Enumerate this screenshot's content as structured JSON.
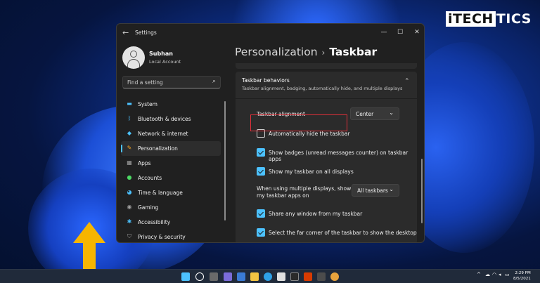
{
  "watermark": {
    "highlight": "iTECH",
    "rest": "TICS"
  },
  "window": {
    "title": "Settings",
    "back_glyph": "←",
    "controls": {
      "minimize": "—",
      "maximize": "☐",
      "close": "✕"
    }
  },
  "profile": {
    "name": "Subhan",
    "account": "Local Account"
  },
  "search": {
    "placeholder": "Find a setting",
    "icon": "search-icon"
  },
  "sidebar": {
    "items": [
      {
        "label": "System",
        "icon": "monitor-icon",
        "color": "#4cc2ff",
        "selected": false
      },
      {
        "label": "Bluetooth & devices",
        "icon": "bluetooth-icon",
        "color": "#4cc2ff",
        "selected": false
      },
      {
        "label": "Network & internet",
        "icon": "wifi-icon",
        "color": "#4cc2ff",
        "selected": false
      },
      {
        "label": "Personalization",
        "icon": "brush-icon",
        "color": "#f5a623",
        "selected": true
      },
      {
        "label": "Apps",
        "icon": "apps-icon",
        "color": "#a0a0a0",
        "selected": false
      },
      {
        "label": "Accounts",
        "icon": "person-icon",
        "color": "#4cd964",
        "selected": false
      },
      {
        "label": "Time & language",
        "icon": "globe-clock-icon",
        "color": "#4cc2ff",
        "selected": false
      },
      {
        "label": "Gaming",
        "icon": "gamepad-icon",
        "color": "#a0a0a0",
        "selected": false
      },
      {
        "label": "Accessibility",
        "icon": "accessibility-icon",
        "color": "#4cc2ff",
        "selected": false
      },
      {
        "label": "Privacy & security",
        "icon": "shield-icon",
        "color": "#a0a0a0",
        "selected": false
      }
    ]
  },
  "breadcrumb": {
    "parent": "Personalization",
    "separator": "›",
    "current": "Taskbar"
  },
  "group": {
    "title": "Taskbar behaviors",
    "subtitle": "Taskbar alignment, badging, automatically hide, and multiple displays",
    "expanded": true,
    "chevron": "⌃"
  },
  "settings": {
    "alignment": {
      "label": "Taskbar alignment",
      "value": "Center"
    },
    "autohide": {
      "label": "Automatically hide the taskbar",
      "checked": false
    },
    "badges": {
      "label": "Show badges (unread messages counter) on taskbar apps",
      "checked": true
    },
    "all_displays": {
      "label": "Show my taskbar on all displays",
      "checked": true
    },
    "multi_display": {
      "label_line1": "When using multiple displays, show",
      "label_line2": "my taskbar apps on",
      "value": "All taskbars"
    },
    "share_window": {
      "label": "Share any window from my taskbar",
      "checked": true
    },
    "far_corner": {
      "label": "Select the far corner of the taskbar to show the desktop",
      "checked": true
    }
  },
  "dropdown_chevron": "⌄",
  "taskbar": {
    "clock_time": "2:29 PM",
    "clock_date": "8/5/2021",
    "tray_chevron": "^",
    "tray_icons": [
      "onedrive-icon",
      "wifi-icon",
      "speaker-icon",
      "battery-icon"
    ]
  },
  "colors": {
    "accent": "#4cc2ff",
    "highlight_box": "#e0303a",
    "arrow": "#f7b500"
  }
}
